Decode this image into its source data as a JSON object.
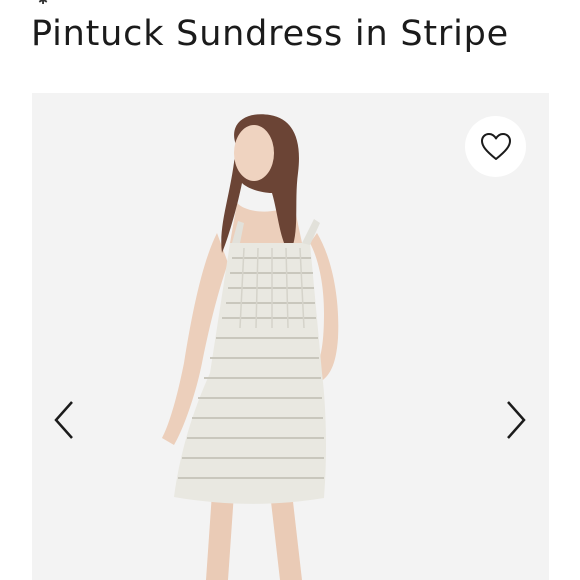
{
  "product": {
    "title": "Pintuck Sundress in Stripe"
  },
  "gallery": {
    "favorite_icon": "heart-outline-icon",
    "prev_icon": "chevron-left-icon",
    "next_icon": "chevron-right-icon"
  },
  "colors": {
    "background": "#ffffff",
    "gallery_bg": "#f2f2f2",
    "text": "#1b1b1b",
    "icon": "#1b1b1b"
  }
}
